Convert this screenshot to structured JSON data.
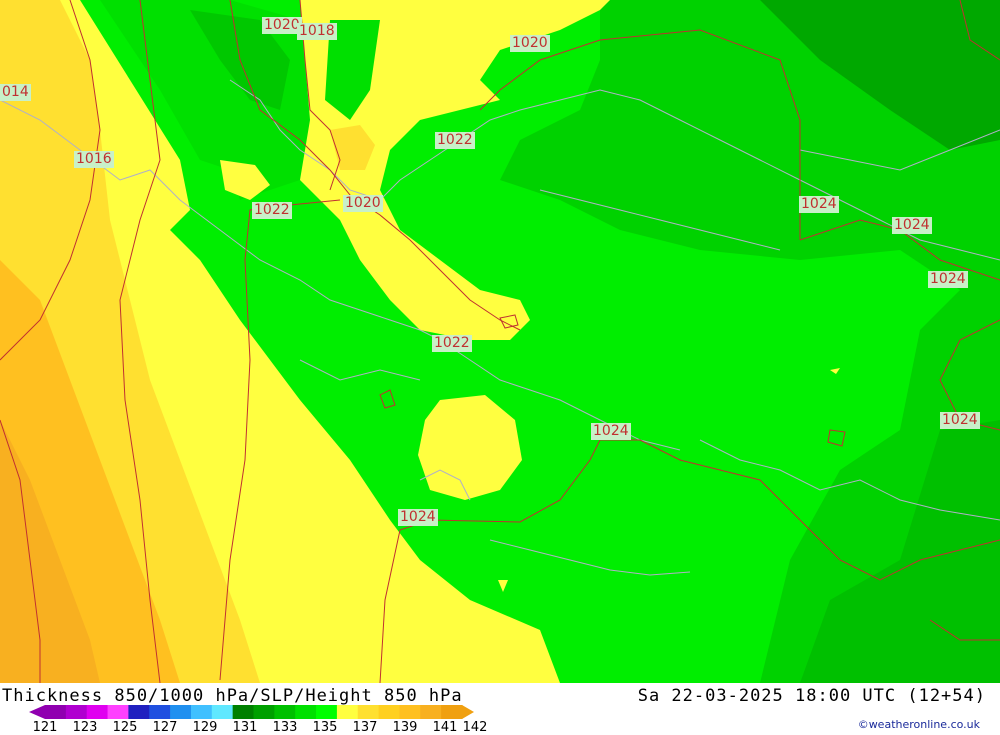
{
  "map": {
    "isobar_labels": [
      {
        "text": "1020"
      },
      {
        "text": "1018"
      },
      {
        "text": "1020"
      },
      {
        "text": "014"
      },
      {
        "text": "1016"
      },
      {
        "text": "1022"
      },
      {
        "text": "1022"
      },
      {
        "text": "1020"
      },
      {
        "text": "1024"
      },
      {
        "text": "1024"
      },
      {
        "text": "1024"
      },
      {
        "text": "1022"
      },
      {
        "text": "1024"
      },
      {
        "text": "1024"
      },
      {
        "text": "1024"
      }
    ],
    "colors": {
      "orange": "#ffc020",
      "deep_orange": "#f8b020",
      "yellow": "#ffff40",
      "light_yellow_orange": "#ffe030",
      "green_bright": "#00ee00",
      "green_mid": "#00d200",
      "green_dark": "#00a800",
      "isobar": "#c03030",
      "coast": "#b0b0c8"
    }
  },
  "footer": {
    "title": "Thickness 850/1000 hPa/SLP/Height 850 hPa",
    "datetime": "Sa 22-03-2025 18:00 UTC (12+54)",
    "credit": "©weatheronline.co.uk"
  },
  "legend": {
    "ticks": [
      "121",
      "123",
      "125",
      "127",
      "129",
      "131",
      "133",
      "135",
      "137",
      "139",
      "141",
      "142"
    ],
    "colors": [
      "#9000b0",
      "#b000d0",
      "#e000f0",
      "#ff40ff",
      "#2020c0",
      "#2050e0",
      "#2090f0",
      "#40c0ff",
      "#60e8ff",
      "#008000",
      "#00a000",
      "#00c000",
      "#00e000",
      "#00ff00",
      "#ffff40",
      "#ffe030",
      "#ffd020",
      "#ffc020",
      "#f8b020",
      "#f0a010"
    ]
  }
}
